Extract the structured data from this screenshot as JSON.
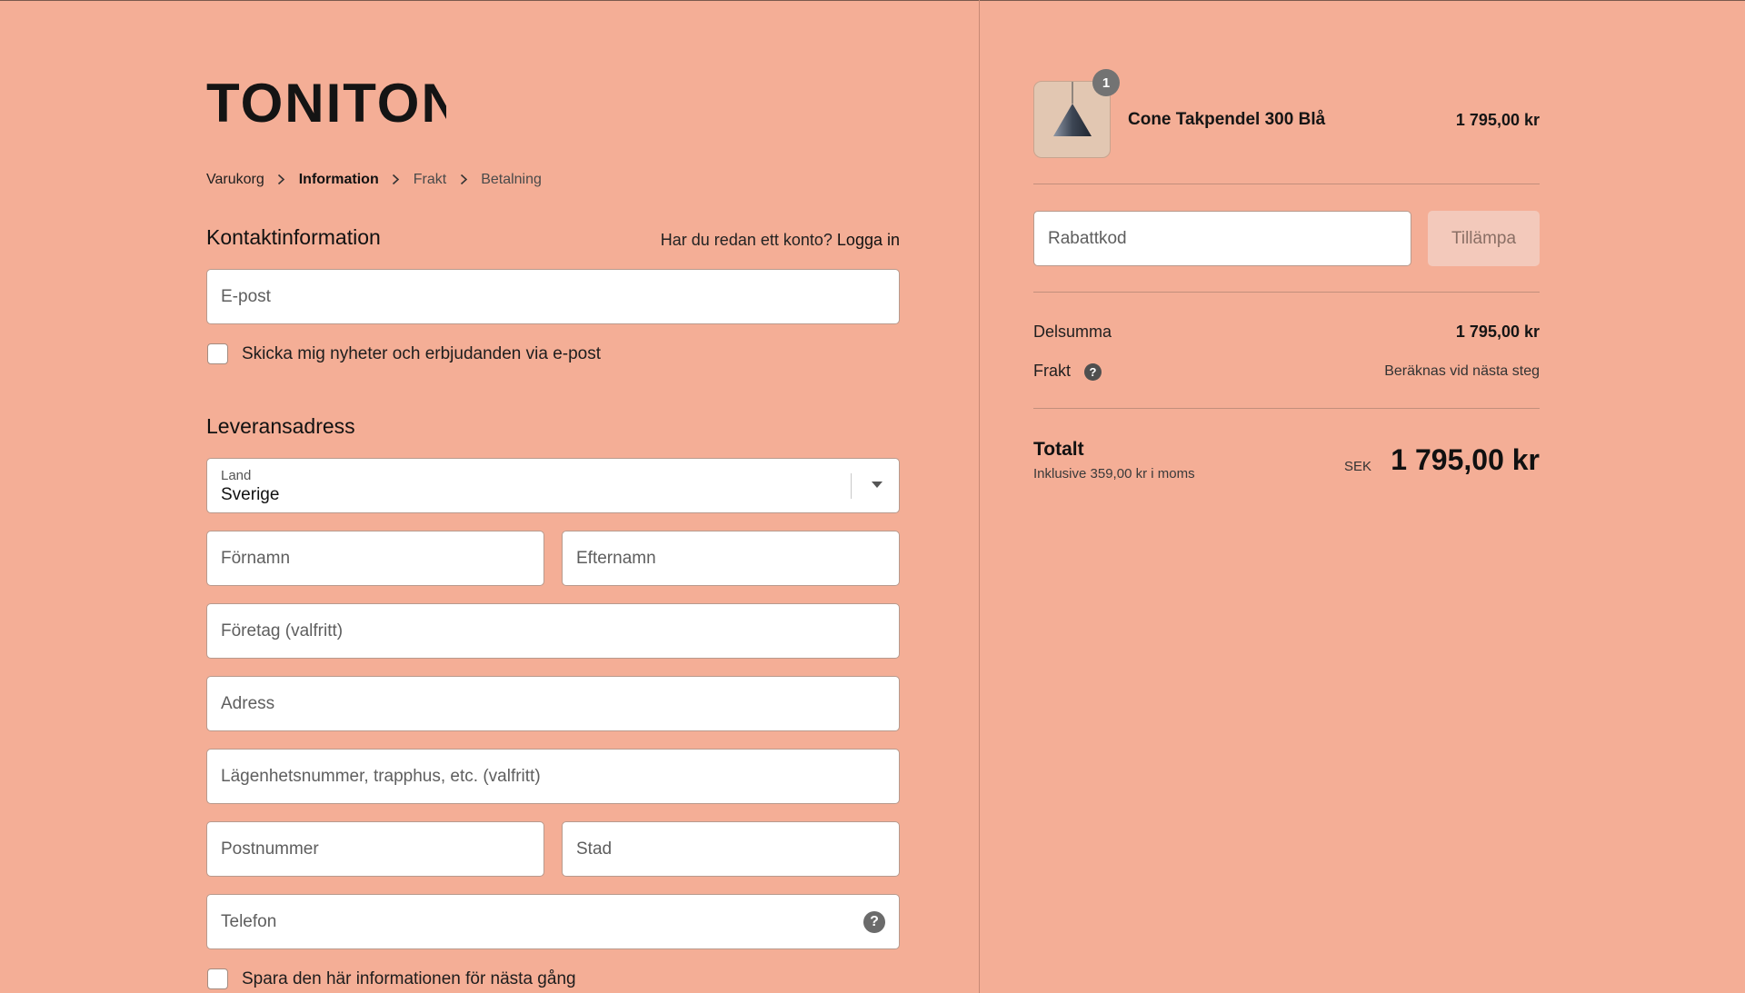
{
  "brand": {
    "name": "TONITON"
  },
  "breadcrumb": {
    "items": [
      {
        "label": "Varukorg"
      },
      {
        "label": "Information"
      },
      {
        "label": "Frakt"
      },
      {
        "label": "Betalning"
      }
    ]
  },
  "contact": {
    "title": "Kontaktinformation",
    "login_prompt": "Har du redan ett konto?",
    "login_link": "Logga in",
    "email_placeholder": "E-post",
    "newsletter_label": "Skicka mig nyheter och erbjudanden via e-post"
  },
  "shipping": {
    "title": "Leveransadress",
    "country_label": "Land",
    "country_value": "Sverige",
    "first_name_placeholder": "Förnamn",
    "last_name_placeholder": "Efternamn",
    "company_placeholder": "Företag (valfritt)",
    "address_placeholder": "Adress",
    "apartment_placeholder": "Lägenhetsnummer, trapphus, etc. (valfritt)",
    "postal_placeholder": "Postnummer",
    "city_placeholder": "Stad",
    "phone_placeholder": "Telefon",
    "phone_help_icon": "?",
    "save_info_label": "Spara den här informationen för nästa gång"
  },
  "summary": {
    "product": {
      "name": "Cone Takpendel 300 Blå",
      "price": "1 795,00 kr",
      "quantity": "1",
      "image_icon": "pendant-lamp-icon"
    },
    "discount_placeholder": "Rabattkod",
    "apply_label": "Tillämpa",
    "subtotal_label": "Delsumma",
    "subtotal_value": "1 795,00 kr",
    "shipping_label": "Frakt",
    "shipping_help_icon": "?",
    "shipping_value": "Beräknas vid nästa steg",
    "total_label": "Totalt",
    "tax_note": "Inklusive 359,00 kr i moms",
    "currency": "SEK",
    "total_value": "1 795,00 kr"
  },
  "colors": {
    "background": "#f4ae96",
    "input_bg": "#ffffff",
    "apply_button_bg": "#f3c9bb"
  }
}
